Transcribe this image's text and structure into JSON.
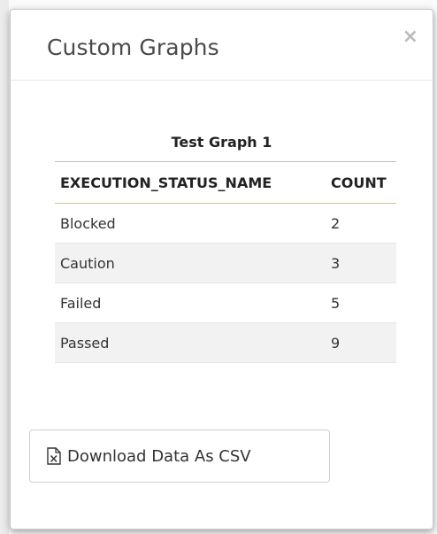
{
  "modal": {
    "title": "Custom Graphs",
    "close_glyph": "×"
  },
  "graph": {
    "title": "Test Graph 1",
    "columns": [
      "EXECUTION_STATUS_NAME",
      "COUNT"
    ],
    "rows": [
      {
        "status": "Blocked",
        "count": "2"
      },
      {
        "status": "Caution",
        "count": "3"
      },
      {
        "status": "Failed",
        "count": "5"
      },
      {
        "status": "Passed",
        "count": "9"
      }
    ]
  },
  "actions": {
    "download_csv_label": "Download Data As CSV",
    "download_icon": "file-excel-icon"
  },
  "colors": {
    "header_rule": "#f0c050",
    "stripe": "#f2f2f2",
    "close": "#bcbcbc"
  }
}
